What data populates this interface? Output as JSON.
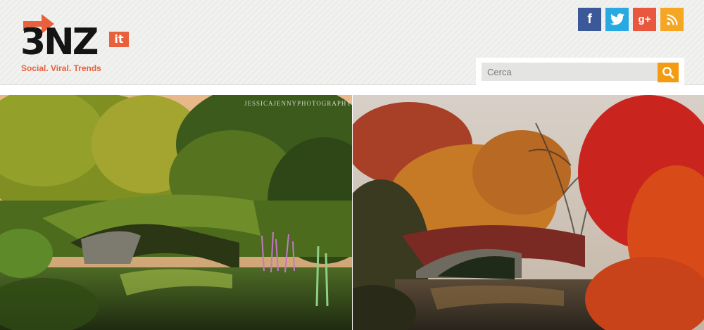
{
  "site": {
    "logo_text": "3NZ",
    "logo_suffix": "it",
    "tagline": "Social. Viral. Trends",
    "brand_color": "#e8603c"
  },
  "social": [
    {
      "name": "facebook",
      "glyph": "f",
      "color": "#3b5998"
    },
    {
      "name": "twitter",
      "glyph": "twitter-bird-icon",
      "color": "#29a9e1"
    },
    {
      "name": "google-plus",
      "glyph": "g+",
      "color": "#e9573f"
    },
    {
      "name": "rss",
      "glyph": "rss-icon",
      "color": "#f5a623"
    }
  ],
  "search": {
    "placeholder": "Cerca",
    "button_icon": "search-icon",
    "button_color": "#f39c12"
  },
  "photos": {
    "left_watermark": "JESSICAJENNYPHOTOGRAPHY"
  }
}
